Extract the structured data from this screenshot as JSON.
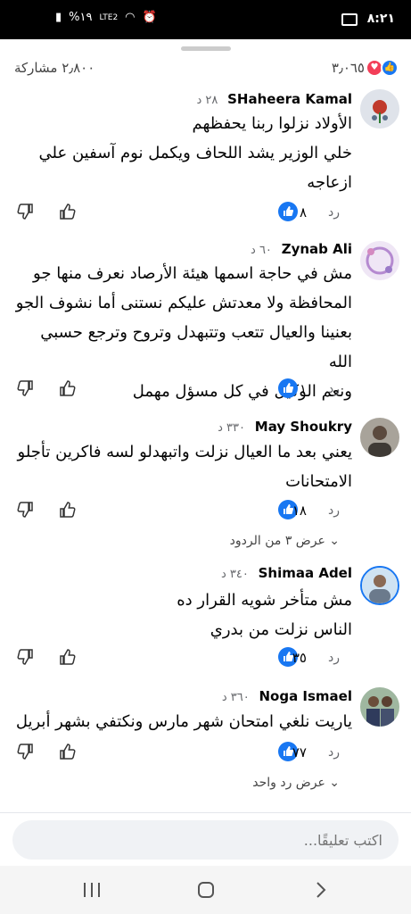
{
  "status_bar": {
    "time": "٨:٢١",
    "battery": "%١٩",
    "network": "LTE2"
  },
  "reactions_bar": {
    "shares": "٢٫٨٠٠ مشاركة",
    "reaction_count": "٣٫٠٦٥"
  },
  "actions": {
    "reply_label": "رد"
  },
  "comments": [
    {
      "name": "SHaheera Kamal",
      "time": "٢٨ د",
      "lines": [
        "الأولاد نزلوا ربنا يحفظهم",
        "خلي الوزير يشد اللحاف ويكمل نوم آسفين علي",
        "ازعاجه"
      ],
      "likes": "٨"
    },
    {
      "name": "Zynab Ali",
      "time": "٦٠ د",
      "lines": [
        "مش في حاجة اسمها هيئة الأرصاد نعرف منها جو",
        "المحافظة  ولا معدتش عليكم نستنى أما نشوف الجو",
        "بعنينا والعيال تتعب وتتبهدل وتروح وترجع حسبي الله",
        "ونعم الوكيل في كل مسؤل مهمل"
      ],
      "likes": "١"
    },
    {
      "name": "May Shoukry",
      "time": "٣٣٠ د",
      "lines": [
        "يعني بعد ما العيال نزلت واتبهدلو لسه فاكرين تأجلو",
        "الامتحانات"
      ],
      "likes": "١٨",
      "view_replies": "عرض ٣ من الردود"
    },
    {
      "name": "Shimaa Adel",
      "time": "٣٤٠ د",
      "lines": [
        "مش متأخر شويه القرار ده",
        "الناس نزلت من بدري"
      ],
      "likes": "٣٥"
    },
    {
      "name": "Noga Ismael",
      "time": "٣٦٠ د",
      "lines": [
        "ياريت نلغي امتحان شهر مارس ونكتفي بشهر أبريل"
      ],
      "likes": "٧٧",
      "view_replies": "عرض رد واحد"
    }
  ],
  "composer": {
    "placeholder": "اكتب تعليقًا..."
  },
  "colors": {
    "like_blue": "#1877f2",
    "love_red": "#f33e58",
    "muted": "#65676b"
  }
}
